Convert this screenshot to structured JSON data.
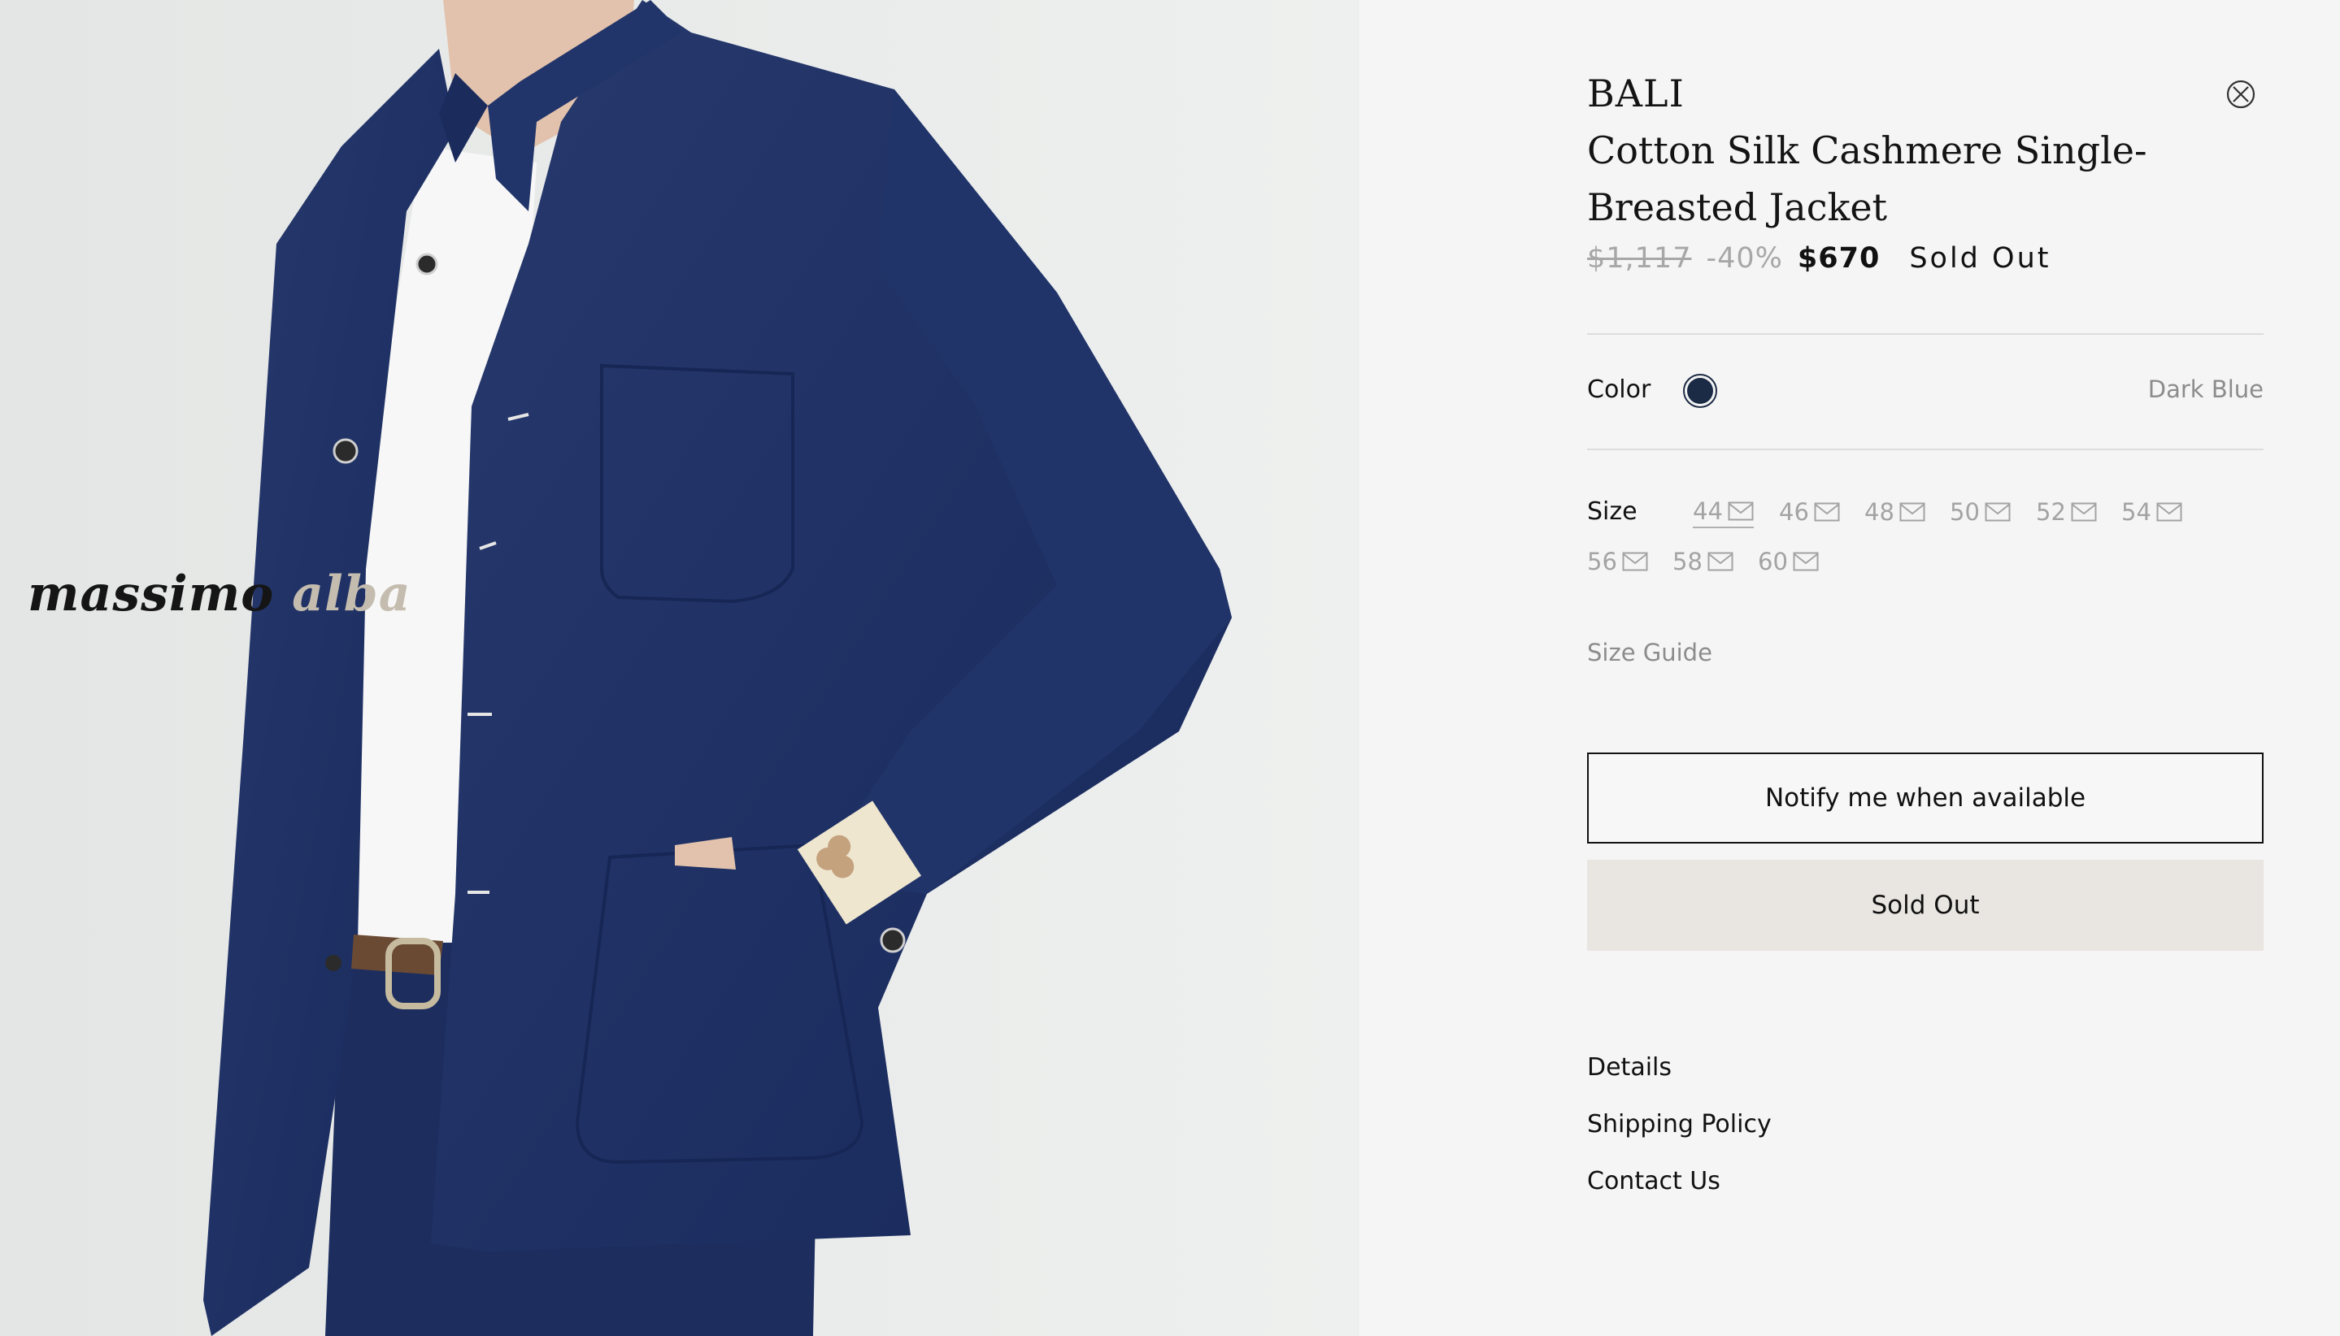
{
  "photo": {
    "logo_text_main": "massimo",
    "logo_text_alt": "alba"
  },
  "product": {
    "brand": "BALI",
    "title": "Cotton Silk Cashmere Single-Breasted Jacket",
    "price_original": "$1,117",
    "price_discount": "-40%",
    "price_current": "$670",
    "status": "Sold Out"
  },
  "color": {
    "label": "Color",
    "value": "Dark Blue",
    "swatch_hex": "#1b2a45"
  },
  "size": {
    "label": "Size",
    "options": [
      "44",
      "46",
      "48",
      "50",
      "52",
      "54",
      "56",
      "58",
      "60"
    ],
    "selected": "44",
    "guide_label": "Size Guide"
  },
  "actions": {
    "notify_label": "Notify me when available",
    "soldout_label": "Sold Out"
  },
  "links": {
    "details": "Details",
    "shipping": "Shipping Policy",
    "contact": "Contact Us"
  },
  "colors": {
    "background": "#f5f5f5",
    "jacket": "#1f3366",
    "soldout_button": "#e9e5e1",
    "muted_text": "#8c8c8c"
  },
  "icons": {
    "close": "close-icon",
    "size_notify": "mail-icon"
  }
}
